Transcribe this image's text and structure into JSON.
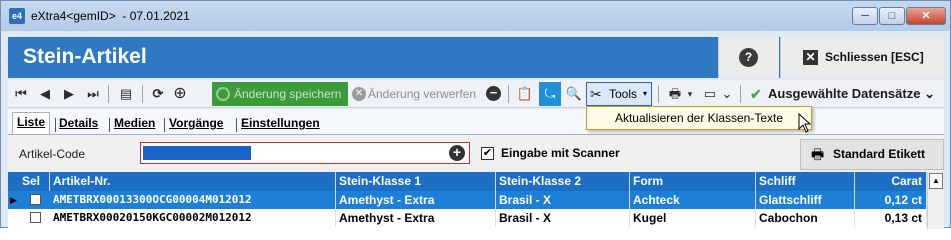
{
  "window": {
    "title": "eXtra4<gemID>  - 07.01.2021",
    "app_icon_text": "e4",
    "min_glyph": "─",
    "max_glyph": "□",
    "close_glyph": "✕"
  },
  "header": {
    "title": "Stein-Artikel",
    "help_label": "?",
    "close_icon": "✕",
    "close_label": "Schliessen [ESC]"
  },
  "toolbar": {
    "first_glyph": "⏮",
    "prev_glyph": "◀",
    "next_glyph": "▶",
    "last_glyph": "⏭",
    "list_glyph": "▤",
    "refresh_glyph": "⟳",
    "add_glyph": "⊕",
    "save_label": "Änderung speichern",
    "discard_glyph": "✕",
    "discard_label": "Änderung verwerfen",
    "minus_glyph": "−",
    "clipboard_glyph": "📋",
    "active_glyph": "⤿",
    "search_glyph": "🔍",
    "tools_glyph": "✂",
    "tools_label": "Tools",
    "tools_caret": "▾",
    "print_glyph": "🖶",
    "print_caret": "▾",
    "layout_glyph": "▭",
    "layout_caret": "⌄",
    "check_glyph": "✔",
    "selected_records_label": "Ausgewählte Datensätze",
    "selected_caret": "⌄"
  },
  "tools_menu": {
    "item": "Aktualisieren der Klassen-Texte"
  },
  "tabs": [
    "Liste",
    "Details",
    "Medien",
    "Vorgänge",
    "Einstellungen"
  ],
  "filter": {
    "article_code_label": "Artikel-Code",
    "add_glyph": "+",
    "scanner_checked": "✔",
    "scanner_label": "Eingabe mit Scanner",
    "label_button_glyph": "🖶",
    "label_button": "Standard Etikett"
  },
  "table": {
    "columns": [
      "Sel",
      "Artikel-Nr.",
      "Stein-Klasse 1",
      "Stein-Klasse 2",
      "Form",
      "Schliff",
      "Carat"
    ],
    "rows": [
      {
        "marker": "▶",
        "article": "AMETBRX00013300OCG00004M012012",
        "class1": "Amethyst - Extra",
        "class2": "Brasil - X",
        "form": "Achteck",
        "cut": "Glattschliff",
        "carat": "0,12 ct"
      },
      {
        "marker": "",
        "article": "AMETBRX00020150KGC00002M012012",
        "class1": "Amethyst - Extra",
        "class2": "Brasil - X",
        "form": "Kugel",
        "cut": "Cabochon",
        "carat": "0,13 ct"
      }
    ],
    "scroll_up_glyph": "▲"
  },
  "colors": {
    "header_blue": "#2e79c2",
    "table_header": "#1d6fc5",
    "selected_row": "#1d7fd8",
    "save_green": "#3c9a3c"
  }
}
